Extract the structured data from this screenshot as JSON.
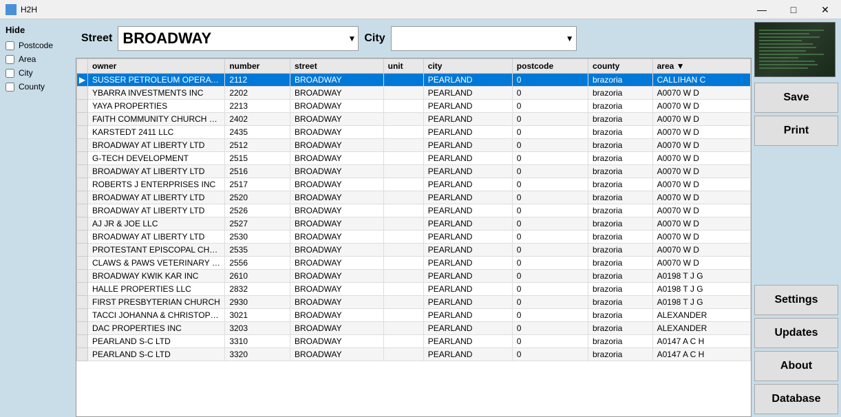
{
  "titleBar": {
    "icon": "H2H",
    "title": "H2H",
    "minimize": "—",
    "maximize": "□",
    "close": "✕"
  },
  "sidebar": {
    "hideLabel": "Hide",
    "checkboxes": [
      {
        "label": "Postcode",
        "checked": false
      },
      {
        "label": "Area",
        "checked": false
      },
      {
        "label": "City",
        "checked": false
      },
      {
        "label": "County",
        "checked": false
      }
    ]
  },
  "searchBar": {
    "streetLabel": "Street",
    "streetValue": "BROADWAY",
    "streetPlaceholder": "",
    "cityLabel": "City",
    "cityValue": "",
    "cityPlaceholder": ""
  },
  "table": {
    "columns": [
      "",
      "owner",
      "number",
      "street",
      "unit",
      "city",
      "postcode",
      "county",
      "area"
    ],
    "rows": [
      {
        "indicator": "▶",
        "owner": "SUSSER PETROLEUM OPERATING COMPANY LLC",
        "number": "2112",
        "street": "BROADWAY",
        "unit": "",
        "city": "PEARLAND",
        "postcode": "0",
        "county": "brazoria",
        "area": "CALLIHAN C",
        "selected": true
      },
      {
        "indicator": "",
        "owner": "YBARRA INVESTMENTS INC",
        "number": "2202",
        "street": "BROADWAY",
        "unit": "",
        "city": "PEARLAND",
        "postcode": "0",
        "county": "brazoria",
        "area": "A0070 W D"
      },
      {
        "indicator": "",
        "owner": "YAYA PROPERTIES",
        "number": "2213",
        "street": "BROADWAY",
        "unit": "",
        "city": "PEARLAND",
        "postcode": "0",
        "county": "brazoria",
        "area": "A0070 W D"
      },
      {
        "indicator": "",
        "owner": "FAITH COMMUNITY CHURCH OF PEARLAND INC",
        "number": "2402",
        "street": "BROADWAY",
        "unit": "",
        "city": "PEARLAND",
        "postcode": "0",
        "county": "brazoria",
        "area": "A0070 W D"
      },
      {
        "indicator": "",
        "owner": "KARSTEDT 2411 LLC",
        "number": "2435",
        "street": "BROADWAY",
        "unit": "",
        "city": "PEARLAND",
        "postcode": "0",
        "county": "brazoria",
        "area": "A0070 W D"
      },
      {
        "indicator": "",
        "owner": "BROADWAY AT LIBERTY LTD",
        "number": "2512",
        "street": "BROADWAY",
        "unit": "",
        "city": "PEARLAND",
        "postcode": "0",
        "county": "brazoria",
        "area": "A0070 W D"
      },
      {
        "indicator": "",
        "owner": "G-TECH DEVELOPMENT",
        "number": "2515",
        "street": "BROADWAY",
        "unit": "",
        "city": "PEARLAND",
        "postcode": "0",
        "county": "brazoria",
        "area": "A0070 W D"
      },
      {
        "indicator": "",
        "owner": "BROADWAY AT LIBERTY LTD",
        "number": "2516",
        "street": "BROADWAY",
        "unit": "",
        "city": "PEARLAND",
        "postcode": "0",
        "county": "brazoria",
        "area": "A0070 W D"
      },
      {
        "indicator": "",
        "owner": "ROBERTS J ENTERPRISES INC",
        "number": "2517",
        "street": "BROADWAY",
        "unit": "",
        "city": "PEARLAND",
        "postcode": "0",
        "county": "brazoria",
        "area": "A0070 W D"
      },
      {
        "indicator": "",
        "owner": "BROADWAY AT LIBERTY LTD",
        "number": "2520",
        "street": "BROADWAY",
        "unit": "",
        "city": "PEARLAND",
        "postcode": "0",
        "county": "brazoria",
        "area": "A0070 W D"
      },
      {
        "indicator": "",
        "owner": "BROADWAY AT LIBERTY LTD",
        "number": "2526",
        "street": "BROADWAY",
        "unit": "",
        "city": "PEARLAND",
        "postcode": "0",
        "county": "brazoria",
        "area": "A0070 W D"
      },
      {
        "indicator": "",
        "owner": "AJ JR & JOE LLC",
        "number": "2527",
        "street": "BROADWAY",
        "unit": "",
        "city": "PEARLAND",
        "postcode": "0",
        "county": "brazoria",
        "area": "A0070 W D"
      },
      {
        "indicator": "",
        "owner": "BROADWAY AT LIBERTY LTD",
        "number": "2530",
        "street": "BROADWAY",
        "unit": "",
        "city": "PEARLAND",
        "postcode": "0",
        "county": "brazoria",
        "area": "A0070 W D"
      },
      {
        "indicator": "",
        "owner": "PROTESTANT EPISCOPAL CHUR",
        "number": "2535",
        "street": "BROADWAY",
        "unit": "",
        "city": "PEARLAND",
        "postcode": "0",
        "county": "brazoria",
        "area": "A0070 W D"
      },
      {
        "indicator": "",
        "owner": "CLAWS & PAWS VETERINARY HOSPITAL PC",
        "number": "2556",
        "street": "BROADWAY",
        "unit": "",
        "city": "PEARLAND",
        "postcode": "0",
        "county": "brazoria",
        "area": "A0070 W D"
      },
      {
        "indicator": "",
        "owner": "BROADWAY KWIK KAR INC",
        "number": "2610",
        "street": "BROADWAY",
        "unit": "",
        "city": "PEARLAND",
        "postcode": "0",
        "county": "brazoria",
        "area": "A0198 T J G"
      },
      {
        "indicator": "",
        "owner": "HALLE PROPERTIES LLC",
        "number": "2832",
        "street": "BROADWAY",
        "unit": "",
        "city": "PEARLAND",
        "postcode": "0",
        "county": "brazoria",
        "area": "A0198 T J G"
      },
      {
        "indicator": "",
        "owner": "FIRST PRESBYTERIAN CHURCH",
        "number": "2930",
        "street": "BROADWAY",
        "unit": "",
        "city": "PEARLAND",
        "postcode": "0",
        "county": "brazoria",
        "area": "A0198 T J G"
      },
      {
        "indicator": "",
        "owner": "TACCI JOHANNA & CHRISTOPHER J",
        "number": "3021",
        "street": "BROADWAY",
        "unit": "",
        "city": "PEARLAND",
        "postcode": "0",
        "county": "brazoria",
        "area": "ALEXANDER"
      },
      {
        "indicator": "",
        "owner": "DAC PROPERTIES INC",
        "number": "3203",
        "street": "BROADWAY",
        "unit": "",
        "city": "PEARLAND",
        "postcode": "0",
        "county": "brazoria",
        "area": "ALEXANDER"
      },
      {
        "indicator": "",
        "owner": "PEARLAND S-C LTD",
        "number": "3310",
        "street": "BROADWAY",
        "unit": "",
        "city": "PEARLAND",
        "postcode": "0",
        "county": "brazoria",
        "area": "A0147 A C H"
      },
      {
        "indicator": "",
        "owner": "PEARLAND S-C LTD",
        "number": "3320",
        "street": "BROADWAY",
        "unit": "",
        "city": "PEARLAND",
        "postcode": "0",
        "county": "brazoria",
        "area": "A0147 A C H"
      }
    ]
  },
  "rightButtons": {
    "save": "Save",
    "print": "Print",
    "settings": "Settings",
    "updates": "Updates",
    "about": "About",
    "database": "Database"
  }
}
